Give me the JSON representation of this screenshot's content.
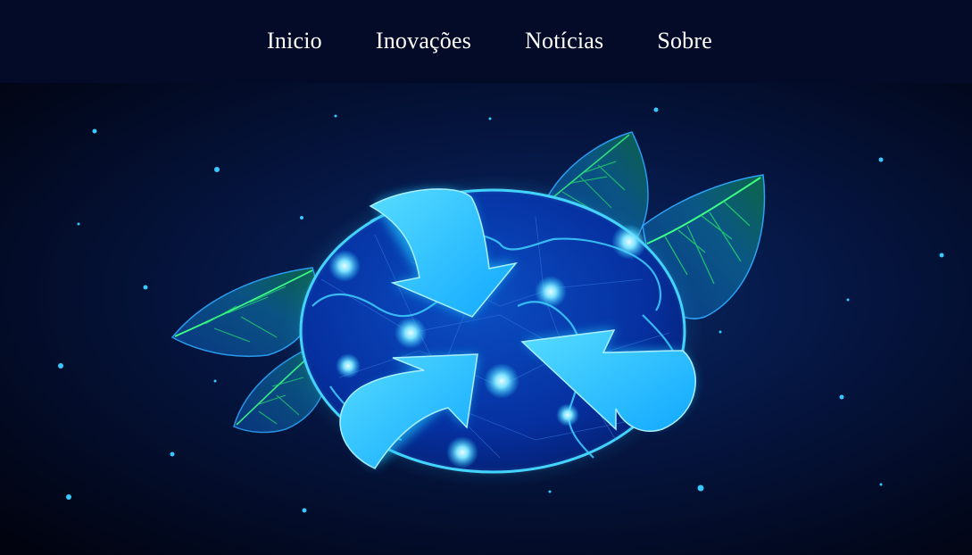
{
  "nav": {
    "items": [
      {
        "label": "Inicio"
      },
      {
        "label": "Inovações"
      },
      {
        "label": "Notícias"
      },
      {
        "label": "Sobre"
      }
    ]
  },
  "hero": {
    "illustration": "recycling-globe-with-leaves",
    "icon": "recycle-arrows-icon"
  },
  "colors": {
    "nav_background": "#030b29",
    "page_background": "#01030f",
    "glow": "#1ec8ff",
    "leaf_green": "#22e05a"
  }
}
